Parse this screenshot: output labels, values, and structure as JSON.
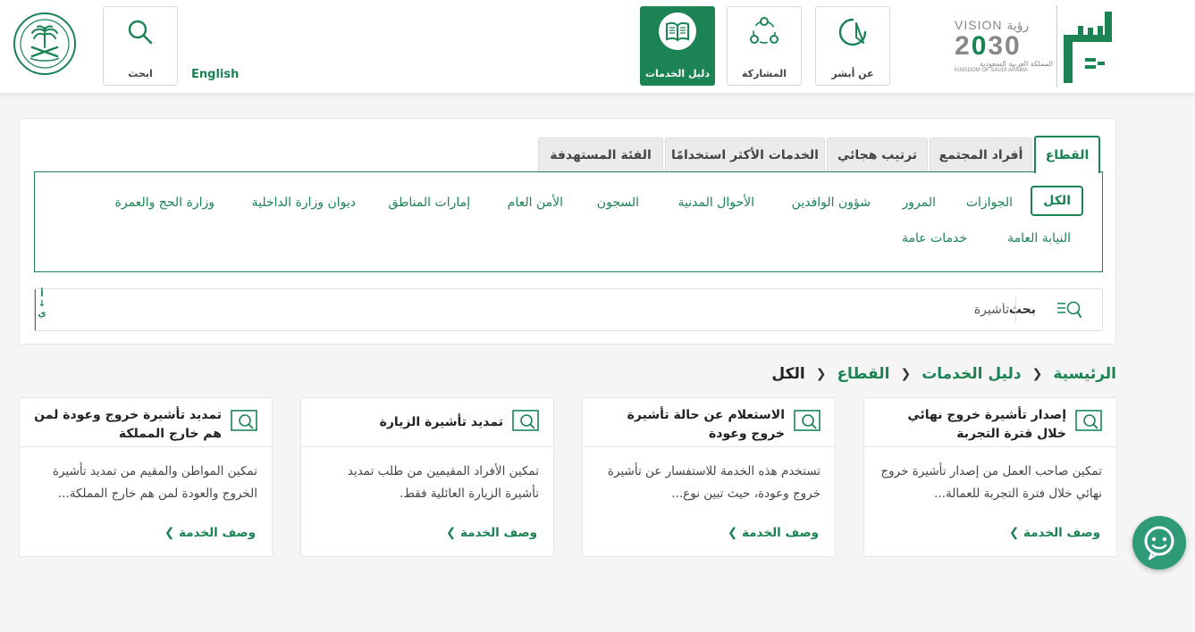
{
  "colors": {
    "brand": "#1b8354",
    "background": "#f5f5f5"
  },
  "header": {
    "search_label": "ابحث",
    "english_label": "English",
    "nav": {
      "services_guide": "دليل الخدمات",
      "participation": "المشاركة",
      "about": "عن أبشر"
    },
    "vision": {
      "top": "VISION رؤية",
      "year_prefix": "2",
      "year_mid": "0",
      "year_suffix": "30",
      "sub_ar": "المملكة العربية السعودية",
      "sub_en": "KINGDOM OF SAUDI ARABIA"
    }
  },
  "tabs": [
    "القطاع",
    "أفراد المجتمع",
    "ترتيب هجائي",
    "الخدمات الأكثر استخدامًا",
    "الفئة المستهدفة"
  ],
  "sectors": [
    "الكل",
    "الجوازات",
    "المرور",
    "شؤون الوافدين",
    "الأحوال المدنية",
    "السجون",
    "الأمن العام",
    "إمارات المناطق",
    "ديوان وزارة الداخلية",
    "وزارة الحج والعمرة",
    "النيابة العامة",
    "خدمات عامة"
  ],
  "search": {
    "label": "بحث",
    "value": "تأشيرة",
    "sort_letters": [
      "أ",
      "↓",
      "ي"
    ]
  },
  "breadcrumb": [
    "الرئيسية",
    "دليل الخدمات",
    "القطاع",
    "الكل"
  ],
  "cards": [
    {
      "title": "إصدار تأشيرة خروج نهائي خلال فترة التجربة",
      "desc": "تمكين صاحب العمل من إصدار تأشيرة خروج نهائي خلال فترة التجربة للعمالة...",
      "link": "وصف الخدمة"
    },
    {
      "title": "الاستعلام عن حالة تأشيرة خروج وعودة",
      "desc": "تستخدم هذه الخدمة للاستفسار عن تأشيرة خروج وعودة، حيث تبين نوع...",
      "link": "وصف الخدمة"
    },
    {
      "title": "تمديد تأشيرة الزيارة",
      "desc": "تمكين الأفراد المقيمين من طلب تمديد تأشيرة الزيارة العائلية فقط.",
      "link": "وصف الخدمة"
    },
    {
      "title": "تمديد تأشيرة خروج وعودة لمن هم خارج المملكة",
      "desc": "تمكين المواطن والمقيم من تمديد تأشيرة الخروج والعودة لمن هم خارج المملكة...",
      "link": "وصف الخدمة"
    }
  ]
}
